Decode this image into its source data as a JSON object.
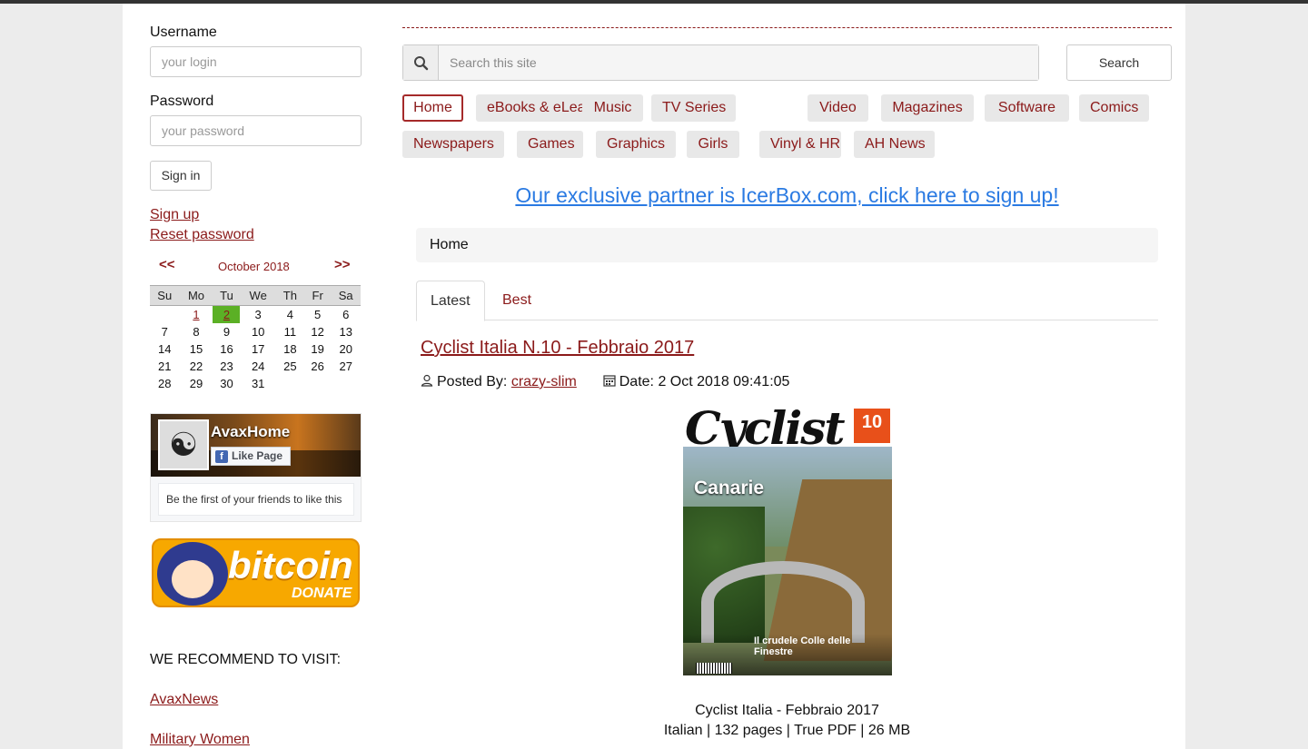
{
  "login": {
    "username_label": "Username",
    "username_placeholder": "your login",
    "password_label": "Password",
    "password_placeholder": "your password",
    "signin_label": "Sign in",
    "signup_link": "Sign up",
    "reset_link": "Reset password"
  },
  "calendar": {
    "prev": "<<",
    "next": ">>",
    "month": "October 2018",
    "weekdays": [
      "Su",
      "Mo",
      "Tu",
      "We",
      "Th",
      "Fr",
      "Sa"
    ],
    "weeks": [
      [
        "",
        "1",
        "2",
        "3",
        "4",
        "5",
        "6"
      ],
      [
        "7",
        "8",
        "9",
        "10",
        "11",
        "12",
        "13"
      ],
      [
        "14",
        "15",
        "16",
        "17",
        "18",
        "19",
        "20"
      ],
      [
        "21",
        "22",
        "23",
        "24",
        "25",
        "26",
        "27"
      ],
      [
        "28",
        "29",
        "30",
        "31",
        "",
        "",
        ""
      ]
    ],
    "linked_days": [
      "1",
      "2"
    ],
    "today": "2",
    "today_color": "#5bb025"
  },
  "facebook": {
    "page_name": "AvaxHome",
    "like_label": "Like Page",
    "friends_text": "Be the first of your friends to like this"
  },
  "bitcoin": {
    "word": "bitcoin",
    "sub": "DONATE"
  },
  "recommend": {
    "title": "WE RECOMMEND TO VISIT:",
    "links": [
      "AvaxNews",
      "Military Women"
    ]
  },
  "search": {
    "placeholder": "Search this site",
    "button_label": "Search"
  },
  "nav": {
    "items": [
      "Home",
      "eBooks & eLearning",
      "Music",
      "TV Series",
      "Video",
      "Magazines",
      "Software",
      "Comics",
      "Newspapers",
      "Games",
      "Graphics",
      "Girls",
      "Vinyl & HR",
      "AH News"
    ],
    "active": "Home"
  },
  "partner_text": "Our exclusive partner is IcerBox.com, click here to sign up!",
  "breadcrumb": "Home",
  "tabs": {
    "latest": "Latest",
    "best": "Best"
  },
  "post": {
    "title": "Cyclist Italia N.10 - Febbraio 2017",
    "posted_by_label": "Posted By:",
    "author": "crazy-slim",
    "date_label": "Date:",
    "date": "2 Oct 2018 09:41:05",
    "cover": {
      "logo": "Cyclist",
      "issue_badge": "10",
      "headline": "Canarie",
      "subline": "Il crudele Colle delle Finestre"
    },
    "caption_title": "Cyclist Italia - Febbraio 2017",
    "caption_info": "Italian | 132 pages | True PDF | 26 MB"
  },
  "colors": {
    "brand_red": "#8b1a1a",
    "partner_blue": "#2a7ae2"
  }
}
